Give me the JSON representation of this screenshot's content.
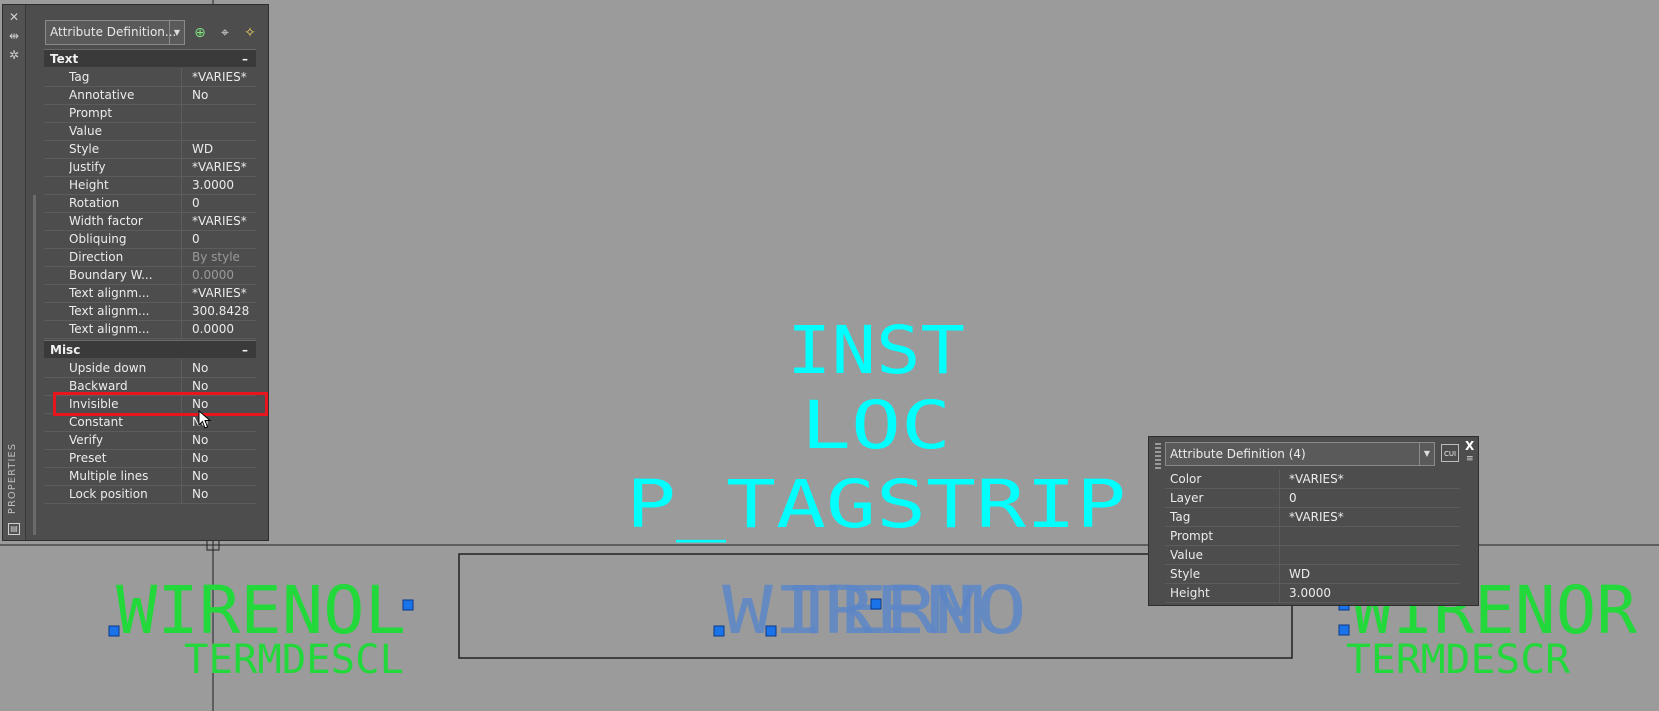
{
  "drawing": {
    "labels": {
      "inst": "INST",
      "loc": "LOC",
      "p_tagstrip": "P_TAGSTRIP",
      "wirenol": "WIRENOL",
      "termdescl": "TERMDESCL",
      "wirenor": "WIRENOR",
      "termdescr": "TERMDESCR",
      "wireno": "WIRENO",
      "term": "TERM"
    },
    "colors": {
      "cyan": "#00ffff",
      "green": "#22d83a",
      "blue": "#5c86c8",
      "grip": "#1a73e8",
      "highlight": "#e8141e",
      "background": "#9b9b9b"
    }
  },
  "palette": {
    "strip_label": "PROPERTIES",
    "strip_icons": [
      "close-icon",
      "auto-hide-icon",
      "settings-icon"
    ],
    "selection": "Attribute  Definition...",
    "toolbar_icons": [
      "toggle-pickadd-icon",
      "select-objects-icon",
      "quick-select-icon"
    ],
    "text_section": {
      "title": "Text",
      "toggle": "–",
      "rows": [
        {
          "name": "Tag",
          "value": "*VARIES*"
        },
        {
          "name": "Annotative",
          "value": "No"
        },
        {
          "name": "Prompt",
          "value": ""
        },
        {
          "name": "Value",
          "value": ""
        },
        {
          "name": "Style",
          "value": "WD"
        },
        {
          "name": "Justify",
          "value": "*VARIES*"
        },
        {
          "name": "Height",
          "value": "3.0000"
        },
        {
          "name": "Rotation",
          "value": "0"
        },
        {
          "name": "Width factor",
          "value": "*VARIES*"
        },
        {
          "name": "Obliquing",
          "value": "0"
        },
        {
          "name": "Direction",
          "value": "By style"
        },
        {
          "name": "Boundary  W...",
          "value": "0.0000"
        },
        {
          "name": "Text alignm...",
          "value": "*VARIES*"
        },
        {
          "name": "Text alignm...",
          "value": "300.8428"
        },
        {
          "name": "Text alignm...",
          "value": "0.0000"
        }
      ]
    },
    "misc_section": {
      "title": "Misc",
      "toggle": "–",
      "rows": [
        {
          "name": "Upside down",
          "value": "No"
        },
        {
          "name": "Backward",
          "value": "No"
        },
        {
          "name": "Invisible",
          "value": "No"
        },
        {
          "name": "Constant",
          "value": "No"
        },
        {
          "name": "Verify",
          "value": "No"
        },
        {
          "name": "Preset",
          "value": "No"
        },
        {
          "name": "Multiple lines",
          "value": "No"
        },
        {
          "name": "Lock position",
          "value": "No"
        }
      ]
    }
  },
  "quick_properties": {
    "selection": "Attribute Definition (4)",
    "cui_label": "CUI",
    "close_label": "X",
    "rows": [
      {
        "name": "Color",
        "value": " *VARIES*"
      },
      {
        "name": "Layer",
        "value": "0"
      },
      {
        "name": "Tag",
        "value": "*VARIES*"
      },
      {
        "name": "Prompt",
        "value": ""
      },
      {
        "name": "Value",
        "value": ""
      },
      {
        "name": "Style",
        "value": "WD"
      },
      {
        "name": "Height",
        "value": "3.0000"
      }
    ]
  }
}
